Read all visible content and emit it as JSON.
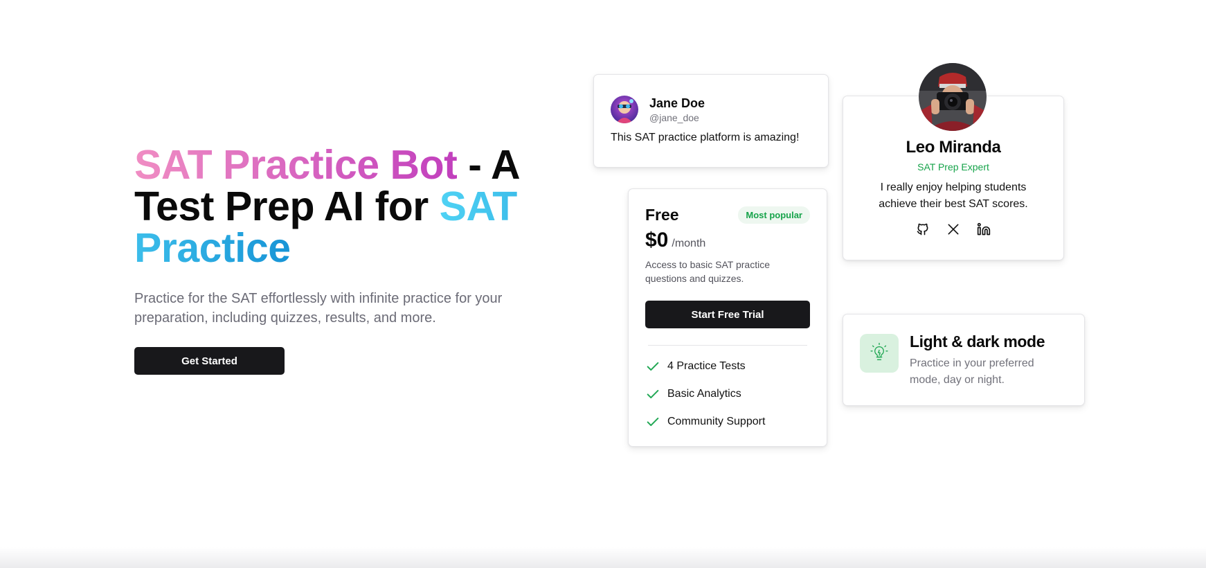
{
  "hero": {
    "title_part1": "SAT Practice Bot",
    "title_part2": " - A Test Prep AI for ",
    "title_part3": "SAT Practice",
    "subtitle": "Practice for the SAT effortlessly with infinite practice for your preparation, including quizzes, results, and more.",
    "cta_label": "Get Started"
  },
  "testimonial": {
    "name": "Jane Doe",
    "handle": "@jane_doe",
    "quote": "This SAT practice platform is amazing!"
  },
  "pricing": {
    "plan": "Free",
    "badge": "Most popular",
    "price": "$0",
    "period": "/month",
    "description": "Access to basic SAT practice questions and quizzes.",
    "cta_label": "Start Free Trial",
    "features": [
      "4 Practice Tests",
      "Basic Analytics",
      "Community Support"
    ]
  },
  "profile": {
    "name": "Leo Miranda",
    "role": "SAT Prep Expert",
    "bio": "I really enjoy helping students achieve their best SAT scores.",
    "socials": [
      "github-icon",
      "x-icon",
      "linkedin-icon"
    ]
  },
  "feature": {
    "title": "Light & dark mode",
    "description": "Practice in your preferred mode, day or night.",
    "icon": "lightbulb-icon"
  },
  "colors": {
    "brand_pink_start": "#f08dc3",
    "brand_pink_end": "#c13fbd",
    "brand_blue_start": "#4fd2f4",
    "brand_blue_end": "#1794d6",
    "accent_green": "#16a34a",
    "button_dark": "#18181b"
  }
}
